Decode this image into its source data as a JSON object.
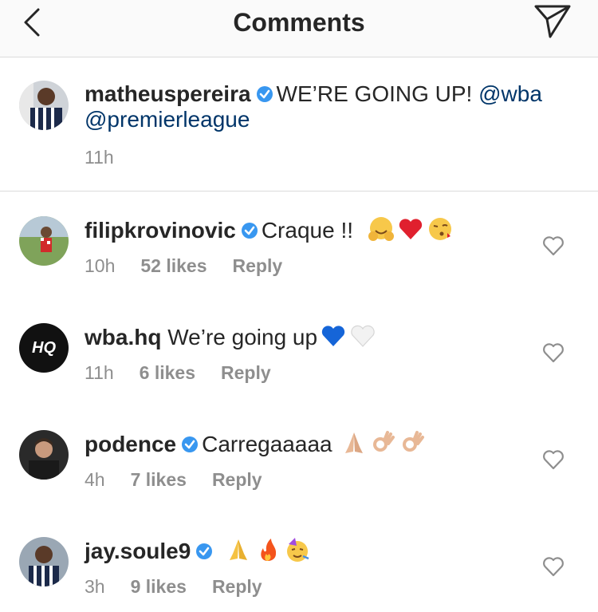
{
  "header": {
    "title": "Comments"
  },
  "caption": {
    "username": "matheuspereira",
    "text": "WE’RE GOING UP!",
    "mention1": "@wba",
    "mention2": "@premierleague",
    "time": "11h"
  },
  "comments": [
    {
      "username": "filipkrovinovic",
      "text": "Craque !!",
      "time": "10h",
      "likes": "52 likes",
      "reply": "Reply"
    },
    {
      "username": "wba.hq",
      "text": "We’re going up",
      "time": "11h",
      "likes": "6 likes",
      "reply": "Reply",
      "avatar_text": "HQ"
    },
    {
      "username": "podence",
      "text": "Carregaaaaa",
      "time": "4h",
      "likes": "7 likes",
      "reply": "Reply"
    },
    {
      "username": "jay.soule9",
      "text": "",
      "time": "3h",
      "likes": "9 likes",
      "reply": "Reply"
    }
  ],
  "colors": {
    "verified": "#3897f0",
    "mention": "#003569",
    "meta": "#8e8e8e",
    "divider": "#dbdbdb"
  }
}
